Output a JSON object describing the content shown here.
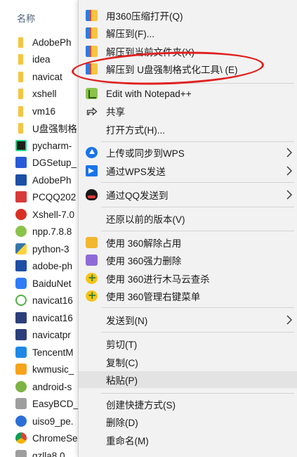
{
  "explorer": {
    "column_header": "名称",
    "files": [
      {
        "name": "AdobePh",
        "icon": "folder-icon"
      },
      {
        "name": "idea",
        "icon": "folder-icon"
      },
      {
        "name": "navicat",
        "icon": "folder-icon"
      },
      {
        "name": "xshell",
        "icon": "folder-icon"
      },
      {
        "name": "vm16",
        "icon": "folder-icon"
      },
      {
        "name": "U盘强制格",
        "icon": "folder-icon"
      },
      {
        "name": "pycharm-",
        "icon": "pycharm-icon"
      },
      {
        "name": "DGSetup_",
        "icon": "dg-setup-icon"
      },
      {
        "name": "AdobePh",
        "icon": "adobe-photoshop-icon"
      },
      {
        "name": "PCQQ202",
        "icon": "qq-installer-icon"
      },
      {
        "name": "Xshell-7.0",
        "icon": "xshell-icon"
      },
      {
        "name": "npp.7.8.8",
        "icon": "notepad-plus-plus-icon"
      },
      {
        "name": "python-3",
        "icon": "python-icon"
      },
      {
        "name": "adobe-ph",
        "icon": "adobe-icon"
      },
      {
        "name": "BaiduNet",
        "icon": "baidu-netdisk-icon"
      },
      {
        "name": "navicat16",
        "icon": "navicat-icon"
      },
      {
        "name": "navicat16",
        "icon": "navicat-doc-icon"
      },
      {
        "name": "navicatpr",
        "icon": "navicat-doc-icon"
      },
      {
        "name": "TencentM",
        "icon": "tencent-meeting-icon"
      },
      {
        "name": "kwmusic_",
        "icon": "kuwo-music-icon"
      },
      {
        "name": "android-s",
        "icon": "android-icon"
      },
      {
        "name": "EasyBCD_",
        "icon": "easybcd-icon"
      },
      {
        "name": "uiso9_pe.",
        "icon": "ultraiso-icon"
      },
      {
        "name": "ChromeSe",
        "icon": "chrome-icon"
      },
      {
        "name": "gzlla8.0",
        "icon": "archive-icon"
      }
    ]
  },
  "context_menu": {
    "items": [
      {
        "label": "用360压缩打开(Q)",
        "icon": "360zip-icon"
      },
      {
        "label": "解压到(F)...",
        "icon": "360zip-icon"
      },
      {
        "label": "解压到当前文件夹(X)",
        "icon": "360zip-icon"
      },
      {
        "label": "解压到 U盘强制格式化工具\\ (E)",
        "icon": "360zip-icon"
      },
      {
        "label": "Edit with Notepad++",
        "icon": "notepad-plus-plus-icon"
      },
      {
        "label": "共享",
        "icon": "share-icon"
      },
      {
        "label": "打开方式(H)...",
        "icon": ""
      },
      {
        "label": "上传或同步到WPS",
        "icon": "wps-cloud-upload-icon",
        "submenu": true
      },
      {
        "label": "通过WPS发送",
        "icon": "wps-send-icon",
        "submenu": true
      },
      {
        "label": "通过QQ发送到",
        "icon": "qq-icon",
        "submenu": true
      },
      {
        "label": "还原以前的版本(V)",
        "icon": ""
      },
      {
        "label": "使用 360解除占用",
        "icon": "360-unlock-icon"
      },
      {
        "label": "使用 360强力删除",
        "icon": "360-shred-icon"
      },
      {
        "label": "使用 360进行木马云查杀",
        "icon": "360-scan-icon"
      },
      {
        "label": "使用 360管理右键菜单",
        "icon": "360-menu-manager-icon"
      },
      {
        "label": "发送到(N)",
        "icon": "",
        "submenu": true
      },
      {
        "label": "剪切(T)",
        "icon": ""
      },
      {
        "label": "复制(C)",
        "icon": ""
      },
      {
        "label": "粘贴(P)",
        "icon": ""
      },
      {
        "label": "创建快捷方式(S)",
        "icon": ""
      },
      {
        "label": "删除(D)",
        "icon": ""
      },
      {
        "label": "重命名(M)",
        "icon": ""
      }
    ],
    "hovered_item": "粘贴(P)",
    "annotation_color": "#e02020"
  }
}
